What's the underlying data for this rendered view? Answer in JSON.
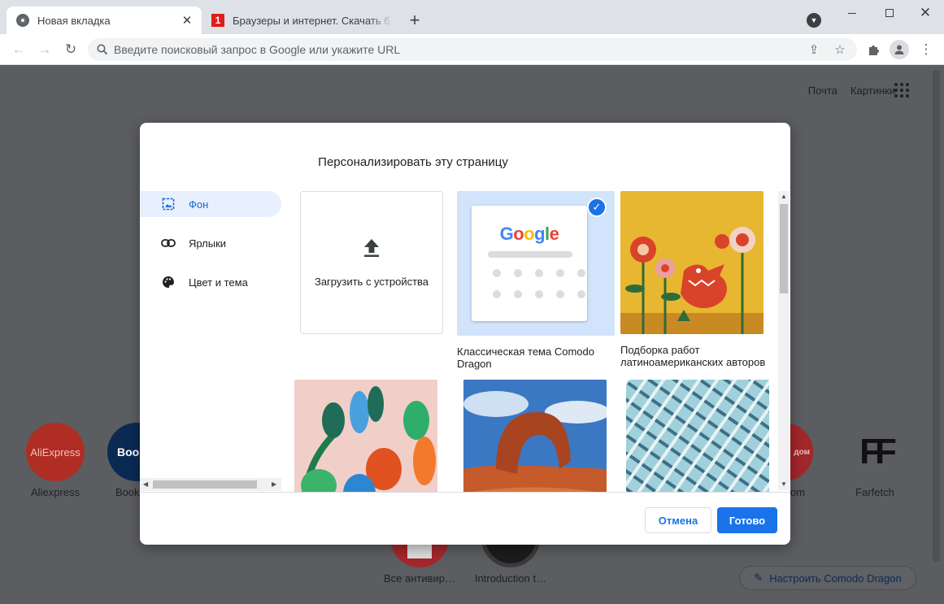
{
  "tabs": [
    {
      "title": "Новая вкладка",
      "icon": "chrome-icon"
    },
    {
      "title": "Браузеры и интернет. Скачать б",
      "icon": "site-favicon-red"
    }
  ],
  "toolbar": {
    "omnibox_placeholder": "Введите поисковый запрос в Google или укажите URL"
  },
  "ntp": {
    "links": [
      "Почта",
      "Картинки"
    ],
    "shortcuts": [
      {
        "label": "Aliexpress",
        "tile_text": "AliExpress",
        "color": "#e43225"
      },
      {
        "label": "Book",
        "tile_text": "Boo",
        "color": "#003580"
      },
      {
        "label": "om",
        "tile_text": "дом",
        "color": "#e31e24"
      },
      {
        "label": "Farfetch",
        "tile_text": "FF",
        "color": "#ffffff"
      },
      {
        "label": "Все антивир…",
        "tile_text": "",
        "color": "#e31e24"
      },
      {
        "label": "Introduction t…",
        "tile_text": "",
        "color": "#222222"
      }
    ],
    "customize_label": "Настроить Comodo Dragon"
  },
  "dialog": {
    "title": "Персонализировать эту страницу",
    "menu": [
      {
        "label": "Фон",
        "icon": "image-icon",
        "active": true
      },
      {
        "label": "Ярлыки",
        "icon": "link-icon",
        "active": false
      },
      {
        "label": "Цвет и тема",
        "icon": "palette-icon",
        "active": false
      }
    ],
    "upload_label": "Загрузить с устройства",
    "backgrounds": [
      {
        "caption": "Классическая тема Comodo Dragon",
        "selected": true
      },
      {
        "caption": "Подборка работ латиноамериканских авторов",
        "selected": false
      },
      {
        "caption": "",
        "selected": false
      },
      {
        "caption": "",
        "selected": false
      },
      {
        "caption": "",
        "selected": false
      }
    ],
    "google_logo": "Google",
    "cancel_label": "Отмена",
    "done_label": "Готово"
  },
  "colors": {
    "accent": "#1a73e8",
    "selected_bg": "#d2e3fc",
    "overlay": "#5b5d60"
  }
}
